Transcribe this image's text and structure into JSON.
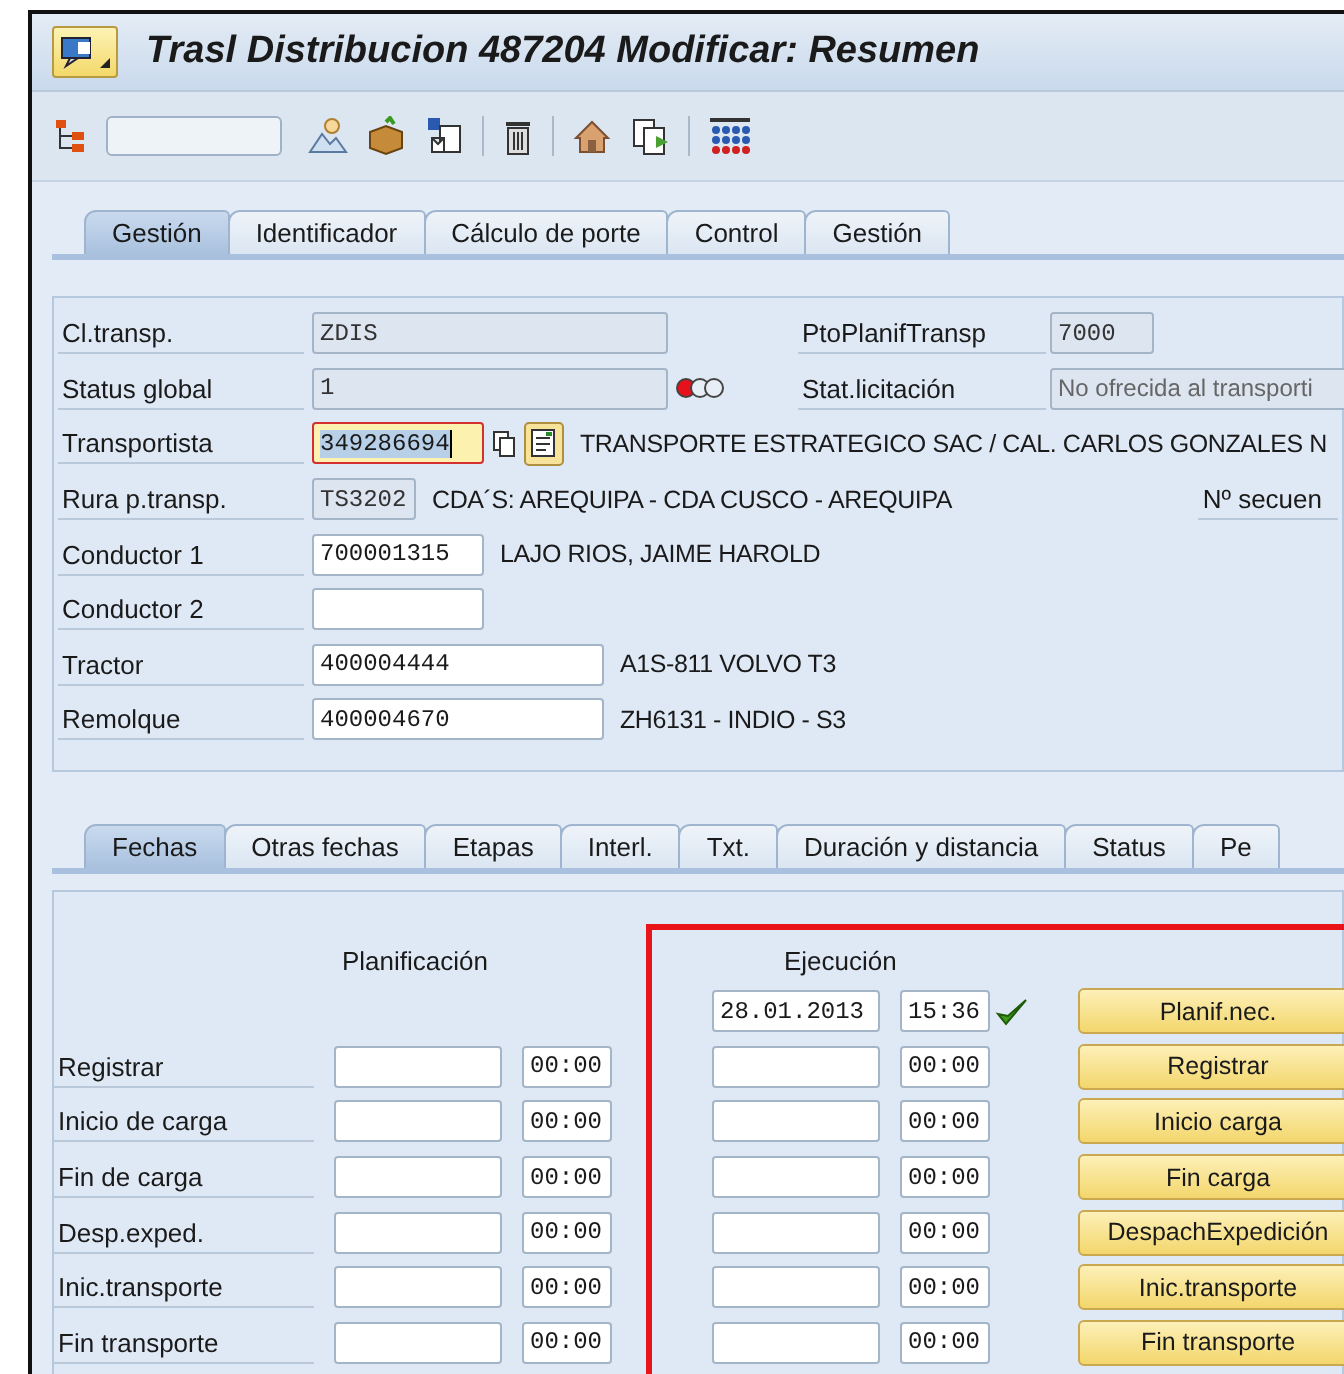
{
  "window": {
    "title": "Trasl Distribucion 487204 Modificar: Resumen"
  },
  "tabs": [
    {
      "label": "Gestión",
      "selected": true
    },
    {
      "label": "Identificador",
      "selected": false
    },
    {
      "label": "Cálculo de porte",
      "selected": false
    },
    {
      "label": "Control",
      "selected": false
    },
    {
      "label": "Gestión",
      "selected": false
    }
  ],
  "header": {
    "rows": [
      {
        "label": "Cl.transp.",
        "value": "ZDIS",
        "kind": "code",
        "right": {
          "label": "PtoPlanifTransp",
          "value": "7000",
          "kind": "short"
        }
      },
      {
        "label": "Status global",
        "value": "1",
        "kind": "code",
        "status_light": {
          "red": true,
          "yellow": false,
          "green": false
        },
        "right": {
          "label": "Stat.licitación",
          "value": "No ofrecida al transporti",
          "kind": "long"
        }
      },
      {
        "label": "Transportista",
        "value": "349286694",
        "kind": "focus",
        "description": "TRANSPORTE ESTRATEGICO SAC / CAL. CARLOS GONZALES N"
      },
      {
        "label": "Rura p.transp.",
        "value": "TS3202",
        "kind": "short",
        "description": "CDA´S: AREQUIPA - CDA CUSCO - AREQUIPA",
        "right": {
          "label": "Nº secuen",
          "kind": "label"
        }
      },
      {
        "label": "Conductor 1",
        "value": "700001315",
        "kind": "entry",
        "description": "LAJO RIOS, JAIME HAROLD"
      },
      {
        "label": "Conductor 2",
        "kind": "entry"
      },
      {
        "label": "Tractor",
        "value": "400004444",
        "kind": "object",
        "description": "A1S-811 VOLVO T3"
      },
      {
        "label": "Remolque",
        "value": "400004670",
        "kind": "object",
        "description": "ZH6131 - INDIO - S3"
      }
    ]
  },
  "detail_tabs": [
    {
      "label": "Fechas",
      "selected": true
    },
    {
      "label": "Otras fechas",
      "selected": false
    },
    {
      "label": "Etapas",
      "selected": false
    },
    {
      "label": "Interl.",
      "selected": false
    },
    {
      "label": "Txt.",
      "selected": false
    },
    {
      "label": "Duración y distancia",
      "selected": false
    },
    {
      "label": "Status",
      "selected": false
    },
    {
      "label": "Pe",
      "selected": false
    }
  ],
  "dates": {
    "planning_heading": "Planificación",
    "execution_heading": "Ejecución",
    "rows": [
      {
        "exec_date": "28.01.2013",
        "exec_time": "15:36",
        "confirmed": true,
        "button": "Planif.nec."
      },
      {
        "label": "Registrar",
        "plan_time": "00:00",
        "exec_time": "00:00",
        "confirmed": false,
        "button": "Registrar"
      },
      {
        "label": "Inicio de carga",
        "plan_time": "00:00",
        "exec_time": "00:00",
        "confirmed": false,
        "button": "Inicio carga"
      },
      {
        "label": "Fin de carga",
        "plan_time": "00:00",
        "exec_time": "00:00",
        "confirmed": false,
        "button": "Fin carga"
      },
      {
        "label": "Desp.exped.",
        "plan_time": "00:00",
        "exec_time": "00:00",
        "confirmed": false,
        "button": "DespachExpedición"
      },
      {
        "label": "Inic.transporte",
        "plan_time": "00:00",
        "exec_time": "00:00",
        "confirmed": false,
        "button": "Inic.transporte"
      },
      {
        "label": "Fin transporte",
        "plan_time": "00:00",
        "exec_time": "00:00",
        "confirmed": false,
        "button": "Fin transporte"
      }
    ]
  }
}
